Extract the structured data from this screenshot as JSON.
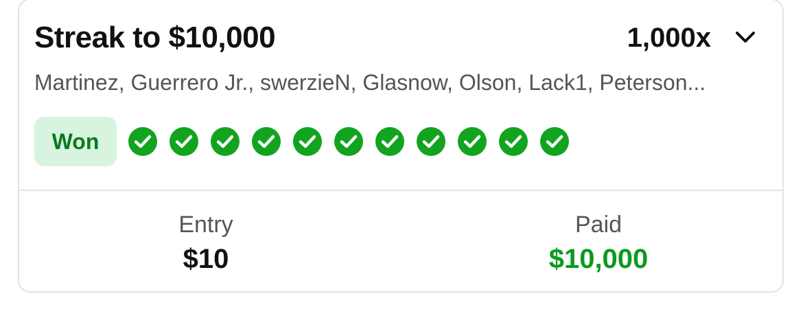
{
  "card": {
    "title": "Streak to $10,000",
    "multiplier": "1,000x",
    "players": "Martinez, Guerrero Jr., swerzieN, Glasnow, Olson, Lack1, Peterson...",
    "status": "Won",
    "legs_won": 11,
    "accent_color": "#12a31f",
    "expand_icon": "chevron-down-icon"
  },
  "footer": {
    "entry_label": "Entry",
    "entry_value": "$10",
    "paid_label": "Paid",
    "paid_value": "$10,000"
  }
}
